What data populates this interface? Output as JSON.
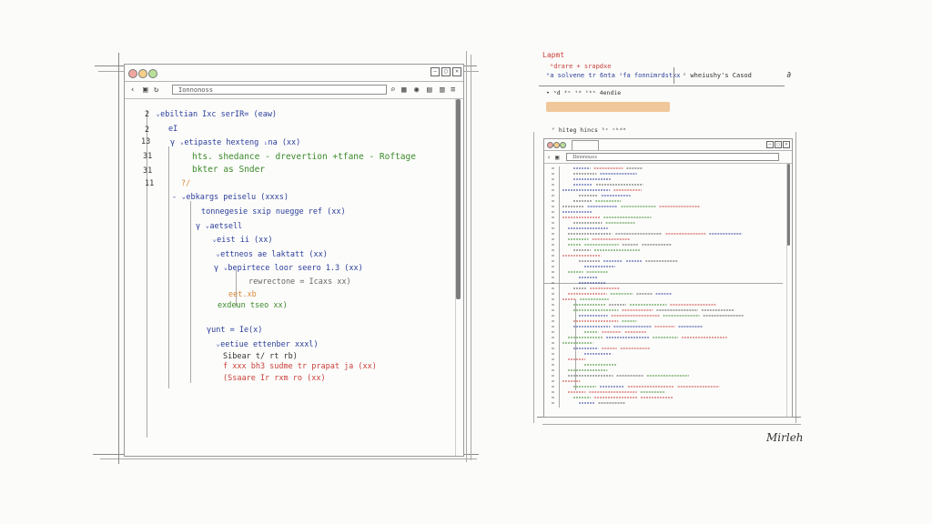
{
  "left_window": {
    "title": "",
    "address": "Ionnonoss",
    "gutter": [
      "2",
      "2",
      "13",
      "31",
      "31",
      "11"
    ],
    "lines": [
      {
        "text": "ᵥebiltian  Ixc  serIR=  (eaw)",
        "color": "blue"
      },
      {
        "text": "eI",
        "color": "blue"
      },
      {
        "text": "γ  ᵥetipaste  hexteng  ᵢna  (xx)",
        "color": "blue"
      },
      {
        "text": "hts.  shedance  -  drevertion  +tfane  -  Roftage",
        "color": "green"
      },
      {
        "text": "bkter  as  Snder",
        "color": "green"
      },
      {
        "text": "?/",
        "color": "orange"
      },
      {
        "text": "- ᵥebkargs  peiselu  (xxxs)",
        "color": "blue"
      },
      {
        "text": "tonnegesie  sxip  nuegge  ref  (xx)",
        "color": "blue"
      },
      {
        "text": "γ  ᵥaetsell",
        "color": "blue"
      },
      {
        "text": "ᵥeist  ii  (xx)",
        "color": "blue"
      },
      {
        "text": "ᵥettneos  ae  laktatt  (xx)",
        "color": "blue"
      },
      {
        "text": "γ  ᵥbepirtece  loor  seero  1.3  (xx)",
        "color": "blue"
      },
      {
        "text": "rewrectone  =  Icaxs  xx)",
        "color": "gray"
      },
      {
        "text": "eet.xb",
        "color": "orange"
      },
      {
        "text": "exdeun  tseo  xx)",
        "color": "green"
      },
      {
        "text": "γunt  =  Ie(x)",
        "color": "blue"
      },
      {
        "text": "ᵥeetiue  ettenber  xxxl)",
        "color": "blue"
      },
      {
        "text": "Sibear  t/  rt  rb)",
        "color": "dark"
      },
      {
        "text": "f  xxx  bh3  sudme  tr  prapat  ja  (xx)",
        "color": "red"
      },
      {
        "text": "(Ssaare  Ir  rxm  ro  (xx)",
        "color": "red"
      }
    ]
  },
  "annotation": {
    "heading": "Lapmt",
    "line1": "ᵃdrare  +  srapdxe",
    "line2": "ᵉa  solvene  tr  6nta  ˢfa  fonnimrdstxx",
    "line3": "ˢ  wheiushy's  Casod",
    "bullet": "•  ˢd  ⁴ˢ  ᵗᵈ  ᵗᵏˢ  4endie",
    "caption": "ᶠ  hiteg  hincs  ⁵ᶜ  ᶜᵏᵈᵉ"
  },
  "right_window": {
    "address": "Ibnonouss",
    "signature": "Mirleh"
  },
  "colors": {
    "highlight": "#f0c79a",
    "blue": "#2b3e9a",
    "green": "#3c8a2a",
    "red": "#c9413a",
    "orange": "#d88a3a"
  }
}
